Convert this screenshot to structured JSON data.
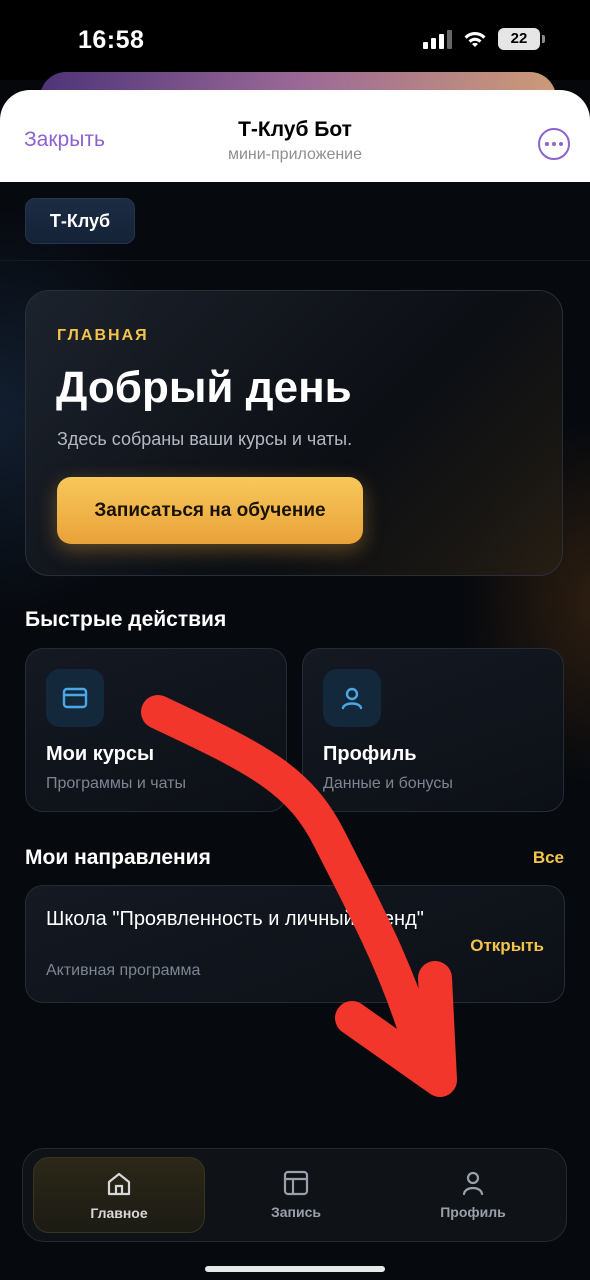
{
  "status_bar": {
    "time": "16:58",
    "battery": "22"
  },
  "header": {
    "close_label": "Закрыть",
    "title": "Т-Клуб Бот",
    "subtitle": "мини-приложение",
    "more_icon": "more-horizontal-icon"
  },
  "brand": {
    "label": "Т-Клуб"
  },
  "hero": {
    "eyebrow": "ГЛАВНАЯ",
    "title": "Добрый день",
    "description": "Здесь собраны ваши курсы и чаты.",
    "button_label": "Записаться на обучение"
  },
  "quick_actions": {
    "title": "Быстрые действия",
    "items": [
      {
        "title": "Мои курсы",
        "subtitle": "Программы и чаты",
        "icon": "courses-window-icon"
      },
      {
        "title": "Профиль",
        "subtitle": "Данные и бонусы",
        "icon": "user-icon"
      }
    ]
  },
  "directions": {
    "title": "Мои направления",
    "all_label": "Все",
    "items": [
      {
        "title": "Школа \"Проявленность и личный бренд\"",
        "status": "Активная программа",
        "action": "Открыть"
      }
    ]
  },
  "bottom_nav": {
    "items": [
      {
        "label": "Главное",
        "icon": "home-icon",
        "active": true
      },
      {
        "label": "Запись",
        "icon": "layout-icon",
        "active": false
      },
      {
        "label": "Профиль",
        "icon": "user-icon",
        "active": false
      }
    ]
  },
  "colors": {
    "accent": "#f3c34b",
    "telegram_link": "#8b62cf",
    "annotation": "#f2362b"
  }
}
